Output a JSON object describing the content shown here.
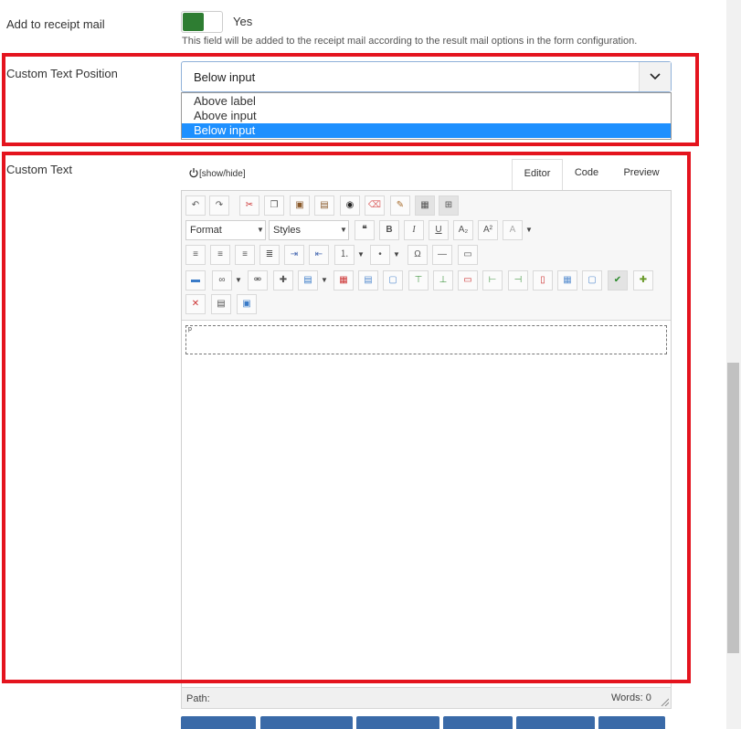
{
  "receipt": {
    "label": "Add to receipt mail",
    "toggle_text": "Yes",
    "help": "This field will be added to the receipt mail according to the result mail options in the form configuration."
  },
  "position": {
    "label": "Custom Text Position",
    "selected": "Below input",
    "options": [
      "Above label",
      "Above input",
      "Below input"
    ]
  },
  "custom_text": {
    "label": "Custom Text",
    "show_hide": "[show/hide]",
    "tabs": [
      "Editor",
      "Code",
      "Preview"
    ],
    "format_label": "Format",
    "styles_label": "Styles",
    "content_tag": "p",
    "path_label": "Path:",
    "words_label": "Words: 0"
  },
  "colors": {
    "accent_red": "#e4141e",
    "toggle_green": "#2e7d32",
    "selected_blue": "#1e90ff"
  }
}
